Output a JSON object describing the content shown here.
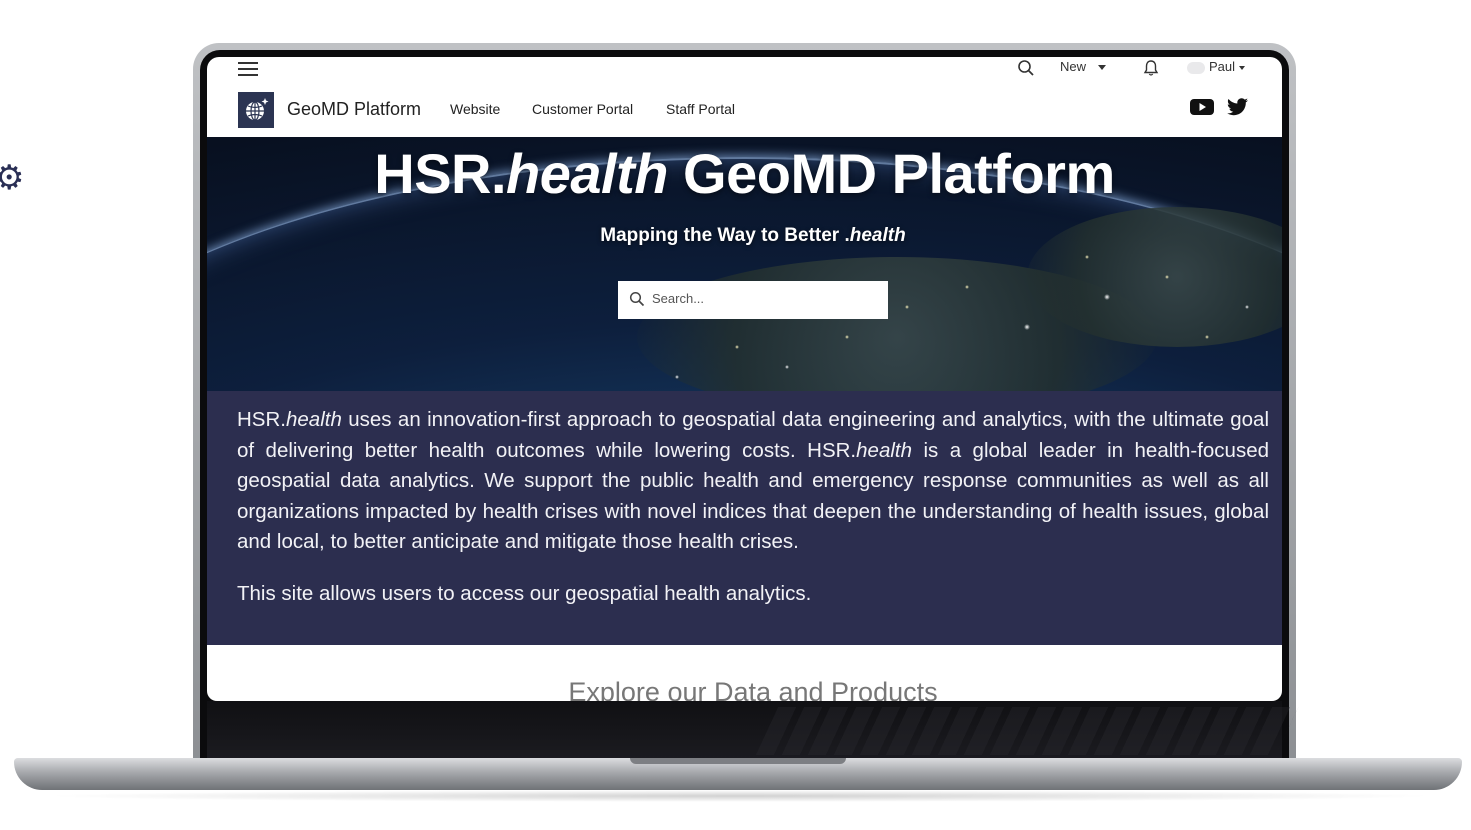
{
  "utility_bar": {
    "new_label": "New",
    "user_name": "Paul"
  },
  "nav": {
    "site_name": "GeoMD Platform",
    "links": [
      "Website",
      "Customer Portal",
      "Staff Portal"
    ],
    "social_icons": [
      "youtube-icon",
      "twitter-icon"
    ]
  },
  "hero": {
    "title_prefix": "HSR.",
    "title_italic": "health",
    "title_suffix": " GeoMD Platform",
    "subtitle_prefix": "Mapping the Way to Better .",
    "subtitle_italic": "health",
    "search_placeholder": "Search..."
  },
  "intro": {
    "p1_a": "HSR.",
    "p1_b": "health",
    "p1_c": " uses an innovation-first approach to geospatial data engineering and analytics, with the ultimate goal of delivering better health outcomes while lowering costs. HSR.",
    "p1_d": "health",
    "p1_e": " is a global leader in health-focused geospatial data analytics. We support the public health and emergency response communities as well as all organizations impacted by health crises with novel indices that deepen the understanding of health issues, global and local, to better anticipate and mitigate those health crises.",
    "p2": "This site allows users to access our geospatial health analytics."
  },
  "explore": {
    "heading": "Explore our Data and Products"
  },
  "colors": {
    "intro_band": "#2c2e4f",
    "logo_bg": "#2b3452",
    "hero_deep": "#081020"
  }
}
